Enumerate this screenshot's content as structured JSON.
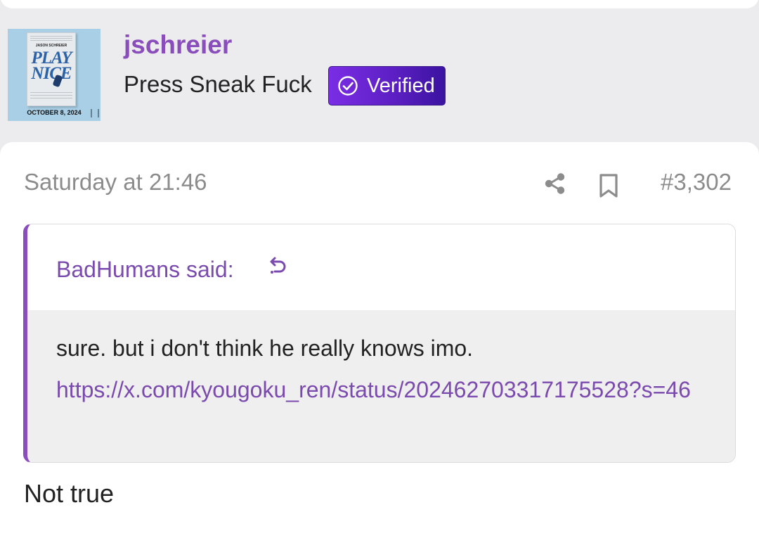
{
  "user": {
    "username": "jschreier",
    "title": "Press Sneak Fuck",
    "badge_label": "Verified",
    "avatar": {
      "author": "JASON SCHREIER",
      "title_line1": "PLAY",
      "title_line2": "NICE",
      "date": "OCTOBER 8, 2024"
    }
  },
  "post": {
    "date": "Saturday at 21:46",
    "number": "#3,302",
    "icons": {
      "share": "share-icon",
      "bookmark": "bookmark-icon"
    },
    "quote": {
      "author_line": "BadHumans said:",
      "jump_icon": "quote-jump-icon",
      "text": "sure. but i don't think he really knows imo.",
      "link": "https://x.com/kyougoku_ren/status/202462703317175528?s=46"
    },
    "reply": "Not true"
  },
  "colors": {
    "accent": "#8a4dbc",
    "link": "#7a4aae",
    "badge_start": "#7a2de5",
    "badge_end": "#3a13a0",
    "muted": "#8c8c8c"
  }
}
